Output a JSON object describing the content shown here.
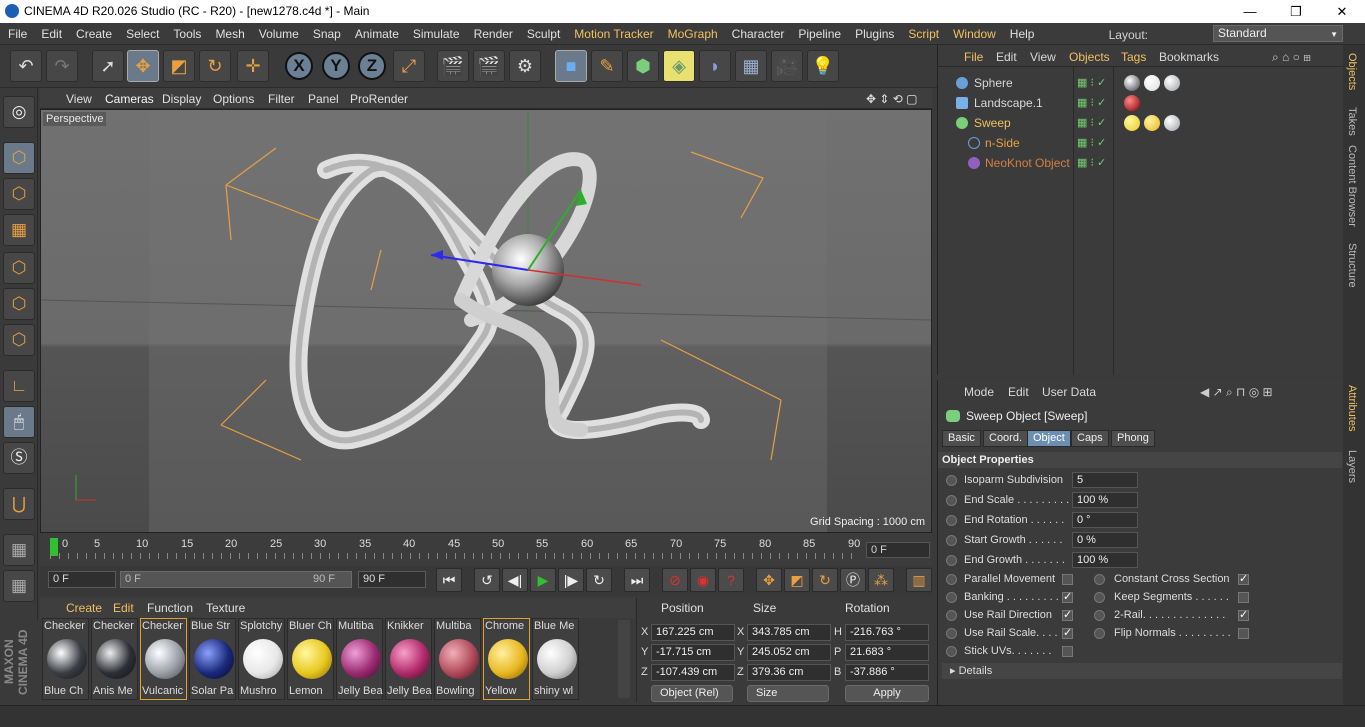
{
  "title": "CINEMA 4D R20.026 Studio (RC - R20) - [new1278.c4d *] - Main",
  "window_controls": {
    "minimize": "—",
    "maximize": "❐",
    "close": "✕"
  },
  "menu": [
    "File",
    "Edit",
    "Create",
    "Select",
    "Tools",
    "Mesh",
    "Volume",
    "Snap",
    "Animate",
    "Simulate",
    "Render",
    "Sculpt",
    "Motion Tracker",
    "MoGraph",
    "Character",
    "Pipeline",
    "Plugins",
    "Script",
    "Window",
    "Help"
  ],
  "layout": {
    "label": "Layout:",
    "value": "Standard"
  },
  "viewport": {
    "menu": [
      "View",
      "Cameras",
      "Display",
      "Options",
      "Filter",
      "Panel",
      "ProRender"
    ],
    "label": "Perspective",
    "grid_spacing": "Grid Spacing : 1000 cm"
  },
  "timeline": {
    "ticks": [
      "0",
      "5",
      "10",
      "15",
      "20",
      "25",
      "30",
      "35",
      "40",
      "45",
      "50",
      "55",
      "60",
      "65",
      "70",
      "75",
      "80",
      "85",
      "90"
    ],
    "current_frame": "0 F"
  },
  "transport": {
    "start": "0 F",
    "range_start": "0 F",
    "range_end": "90 F",
    "end": "90 F"
  },
  "materials": {
    "menu": [
      "Create",
      "Edit",
      "Function",
      "Texture"
    ],
    "items": [
      {
        "top": "Checker",
        "bottom": "Blue Ch",
        "color": "#3a3d44"
      },
      {
        "top": "Checker",
        "bottom": "Anis Me",
        "color": "#2c2f36"
      },
      {
        "top": "Checker",
        "bottom": "Vulcanic",
        "color": "#9aa0a8"
      },
      {
        "top": "Blue Str",
        "bottom": "Solar Pa",
        "color": "#1a2a7a"
      },
      {
        "top": "Splotchy",
        "bottom": "Mushro",
        "color": "#e8e8e8"
      },
      {
        "top": "Bluer Ch",
        "bottom": "Lemon",
        "color": "#e8c820"
      },
      {
        "top": "Multiba",
        "bottom": "Jelly Bea",
        "color": "#9a2a70"
      },
      {
        "top": "Knikker",
        "bottom": "Jelly Bea",
        "color": "#b02a6a"
      },
      {
        "top": "Multiba",
        "bottom": "Bowling",
        "color": "#b04a5a"
      },
      {
        "top": "Chrome",
        "bottom": "Yellow",
        "color": "#e8b820"
      },
      {
        "top": "Blue Me",
        "bottom": "shiny wl",
        "color": "#d0d0d0"
      }
    ]
  },
  "coords": {
    "headers": [
      "Position",
      "Size",
      "Rotation"
    ],
    "rows": [
      {
        "axis": "X",
        "pos": "167.225 cm",
        "sizeaxis": "X",
        "size": "343.785 cm",
        "rotaxis": "H",
        "rot": "-216.763 °"
      },
      {
        "axis": "Y",
        "pos": "-17.715 cm",
        "sizeaxis": "Y",
        "size": "245.052 cm",
        "rotaxis": "P",
        "rot": "21.683 °"
      },
      {
        "axis": "Z",
        "pos": "-107.439 cm",
        "sizeaxis": "Z",
        "size": "379.36 cm",
        "rotaxis": "B",
        "rot": "-37.886 °"
      }
    ],
    "mode": "Object (Rel)",
    "size_mode": "Size",
    "apply": "Apply"
  },
  "objects": {
    "menu": [
      "File",
      "Edit",
      "View",
      "Objects",
      "Tags",
      "Bookmarks"
    ],
    "items": [
      {
        "name": "Sphere",
        "color": "#8ab8e0",
        "icon": "#6aa0d8"
      },
      {
        "name": "Landscape.1",
        "color": "#c8c8c8",
        "icon": "#7ab0e8"
      },
      {
        "name": "Sweep",
        "color": "#f0c060",
        "icon": "#7ad07a"
      },
      {
        "name": "n-Side",
        "color": "#e8a040",
        "icon": "#6aa0d8"
      },
      {
        "name": "NeoKnot Object",
        "color": "#d08040",
        "icon": "#9060c0"
      }
    ]
  },
  "attributes": {
    "menu": [
      "Mode",
      "Edit",
      "User Data"
    ],
    "title": "Sweep Object [Sweep]",
    "tabs": [
      "Basic",
      "Coord.",
      "Object",
      "Caps",
      "Phong"
    ],
    "section": "Object Properties",
    "fields": [
      {
        "label": "Isoparm Subdivision",
        "value": "5"
      },
      {
        "label": "End Scale . . . . . . . . .",
        "value": "100 %"
      },
      {
        "label": "End Rotation . . . . . .",
        "value": "0 °"
      },
      {
        "label": "Start Growth . . . . . .",
        "value": "0 %"
      },
      {
        "label": "End Growth . . . . . . .",
        "value": "100 %"
      }
    ],
    "checks_left": [
      {
        "label": "Parallel Movement",
        "checked": ""
      },
      {
        "label": "Banking . . . . . . . . .",
        "checked": "✓"
      },
      {
        "label": "Use Rail Direction",
        "checked": "✓"
      },
      {
        "label": "Use Rail Scale. . . .",
        "checked": "✓"
      },
      {
        "label": "Stick UVs. . . . . . .",
        "checked": ""
      }
    ],
    "checks_right": [
      {
        "label": "Constant Cross Section",
        "checked": "✓"
      },
      {
        "label": "Keep Segments . . . . . .",
        "checked": ""
      },
      {
        "label": "2-Rail. . . . . . . . . . . . . .",
        "checked": "✓"
      },
      {
        "label": "Flip Normals . . . . . . . . .",
        "checked": ""
      }
    ],
    "details": "Details"
  },
  "side_tabs": [
    "Objects",
    "Takes",
    "Content Browser",
    "Structure",
    "Attributes",
    "Layers"
  ],
  "brand": "MAXON CINEMA 4D"
}
